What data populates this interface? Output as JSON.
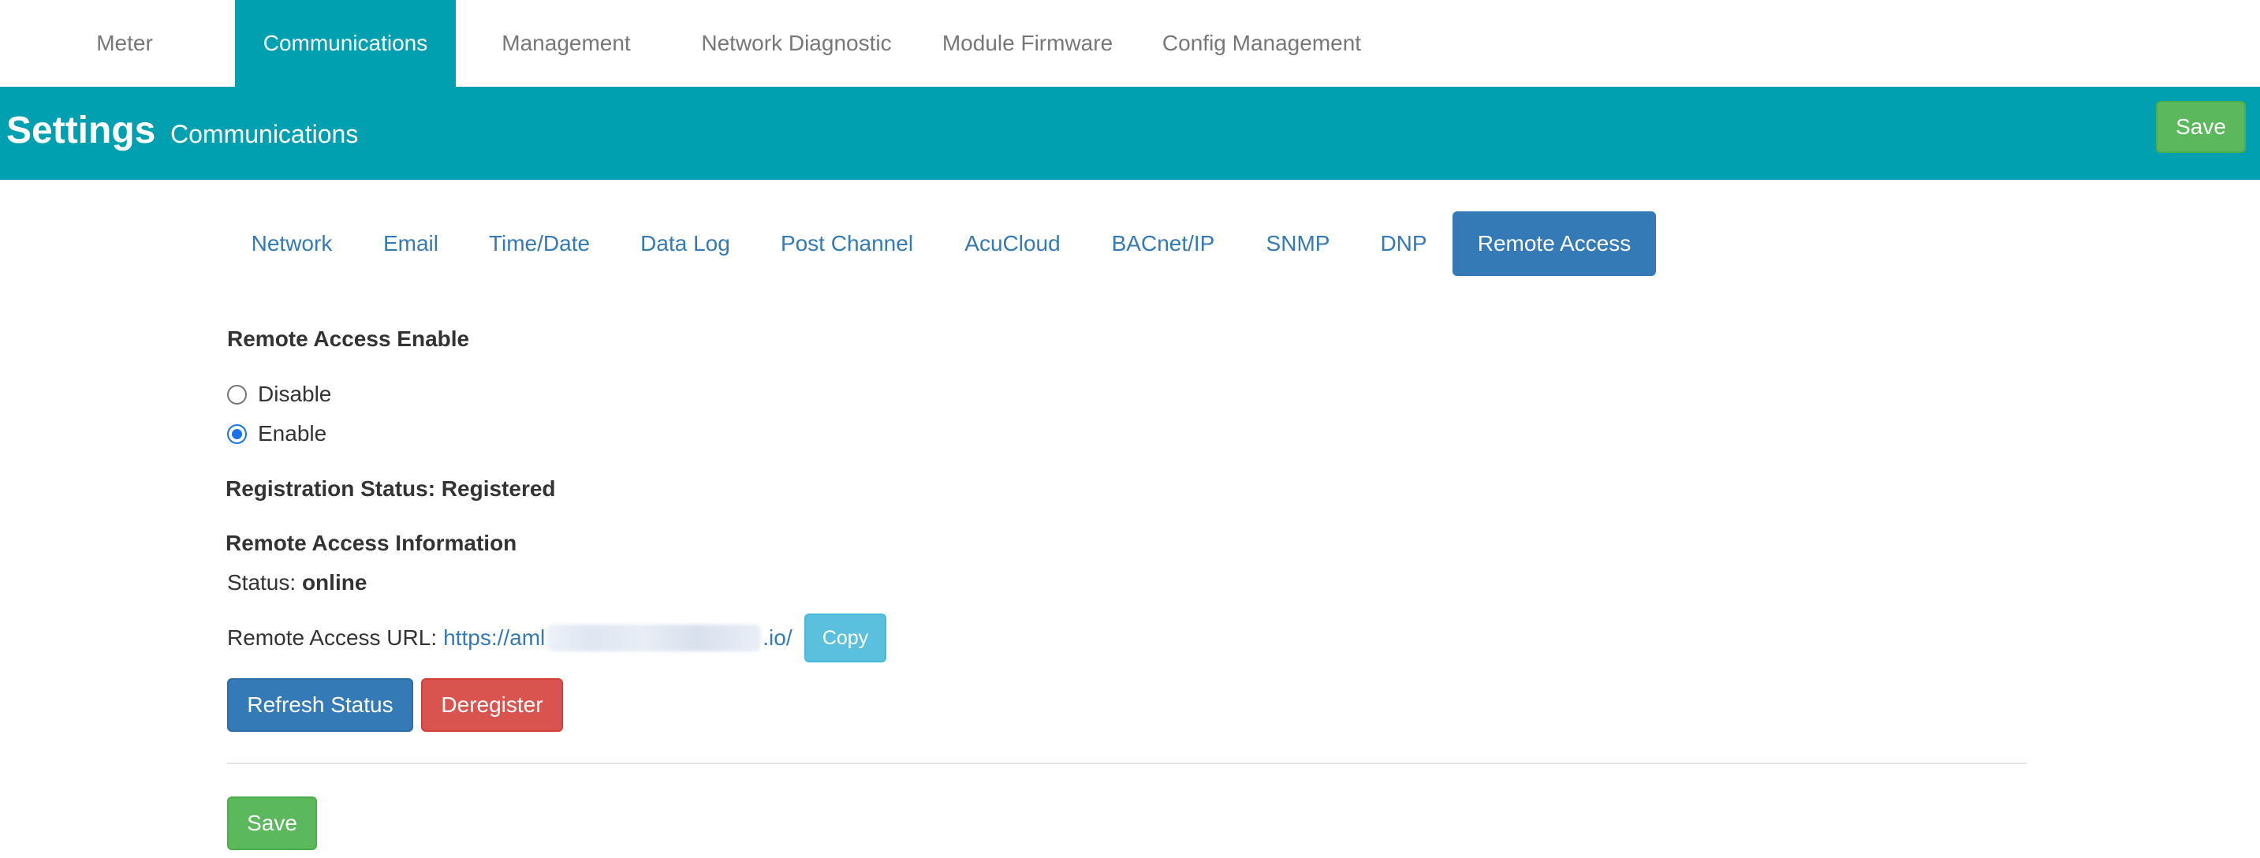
{
  "topnav": {
    "items": [
      {
        "label": "Meter"
      },
      {
        "label": "Communications"
      },
      {
        "label": "Management"
      },
      {
        "label": "Network Diagnostic"
      },
      {
        "label": "Module Firmware"
      },
      {
        "label": "Config Management"
      }
    ],
    "active": "Communications"
  },
  "header": {
    "title": "Settings",
    "subtitle": "Communications",
    "save_label": "Save"
  },
  "subtabs": {
    "items": [
      {
        "label": "Network"
      },
      {
        "label": "Email"
      },
      {
        "label": "Time/Date"
      },
      {
        "label": "Data Log"
      },
      {
        "label": "Post Channel"
      },
      {
        "label": "AcuCloud"
      },
      {
        "label": "BACnet/IP"
      },
      {
        "label": "SNMP"
      },
      {
        "label": "DNP"
      },
      {
        "label": "Remote Access"
      }
    ],
    "active": "Remote Access"
  },
  "remote_access": {
    "enable_heading": "Remote Access Enable",
    "options": [
      {
        "label": "Disable",
        "checked": false
      },
      {
        "label": "Enable",
        "checked": true
      }
    ],
    "registration_status": "Registration Status: Registered",
    "info_heading": "Remote Access Information",
    "status_label": "Status:",
    "status_value": "online",
    "url_label": "Remote Access URL:",
    "url_prefix": "https://aml",
    "url_suffix": ".io/",
    "copy_label": "Copy",
    "refresh_label": "Refresh Status",
    "deregister_label": "Deregister",
    "save_label": "Save"
  },
  "colors": {
    "brand_teal": "#00a0b0",
    "primary": "#337ab7",
    "success": "#5cb85c",
    "danger": "#d9534f",
    "info": "#5bc0de"
  }
}
